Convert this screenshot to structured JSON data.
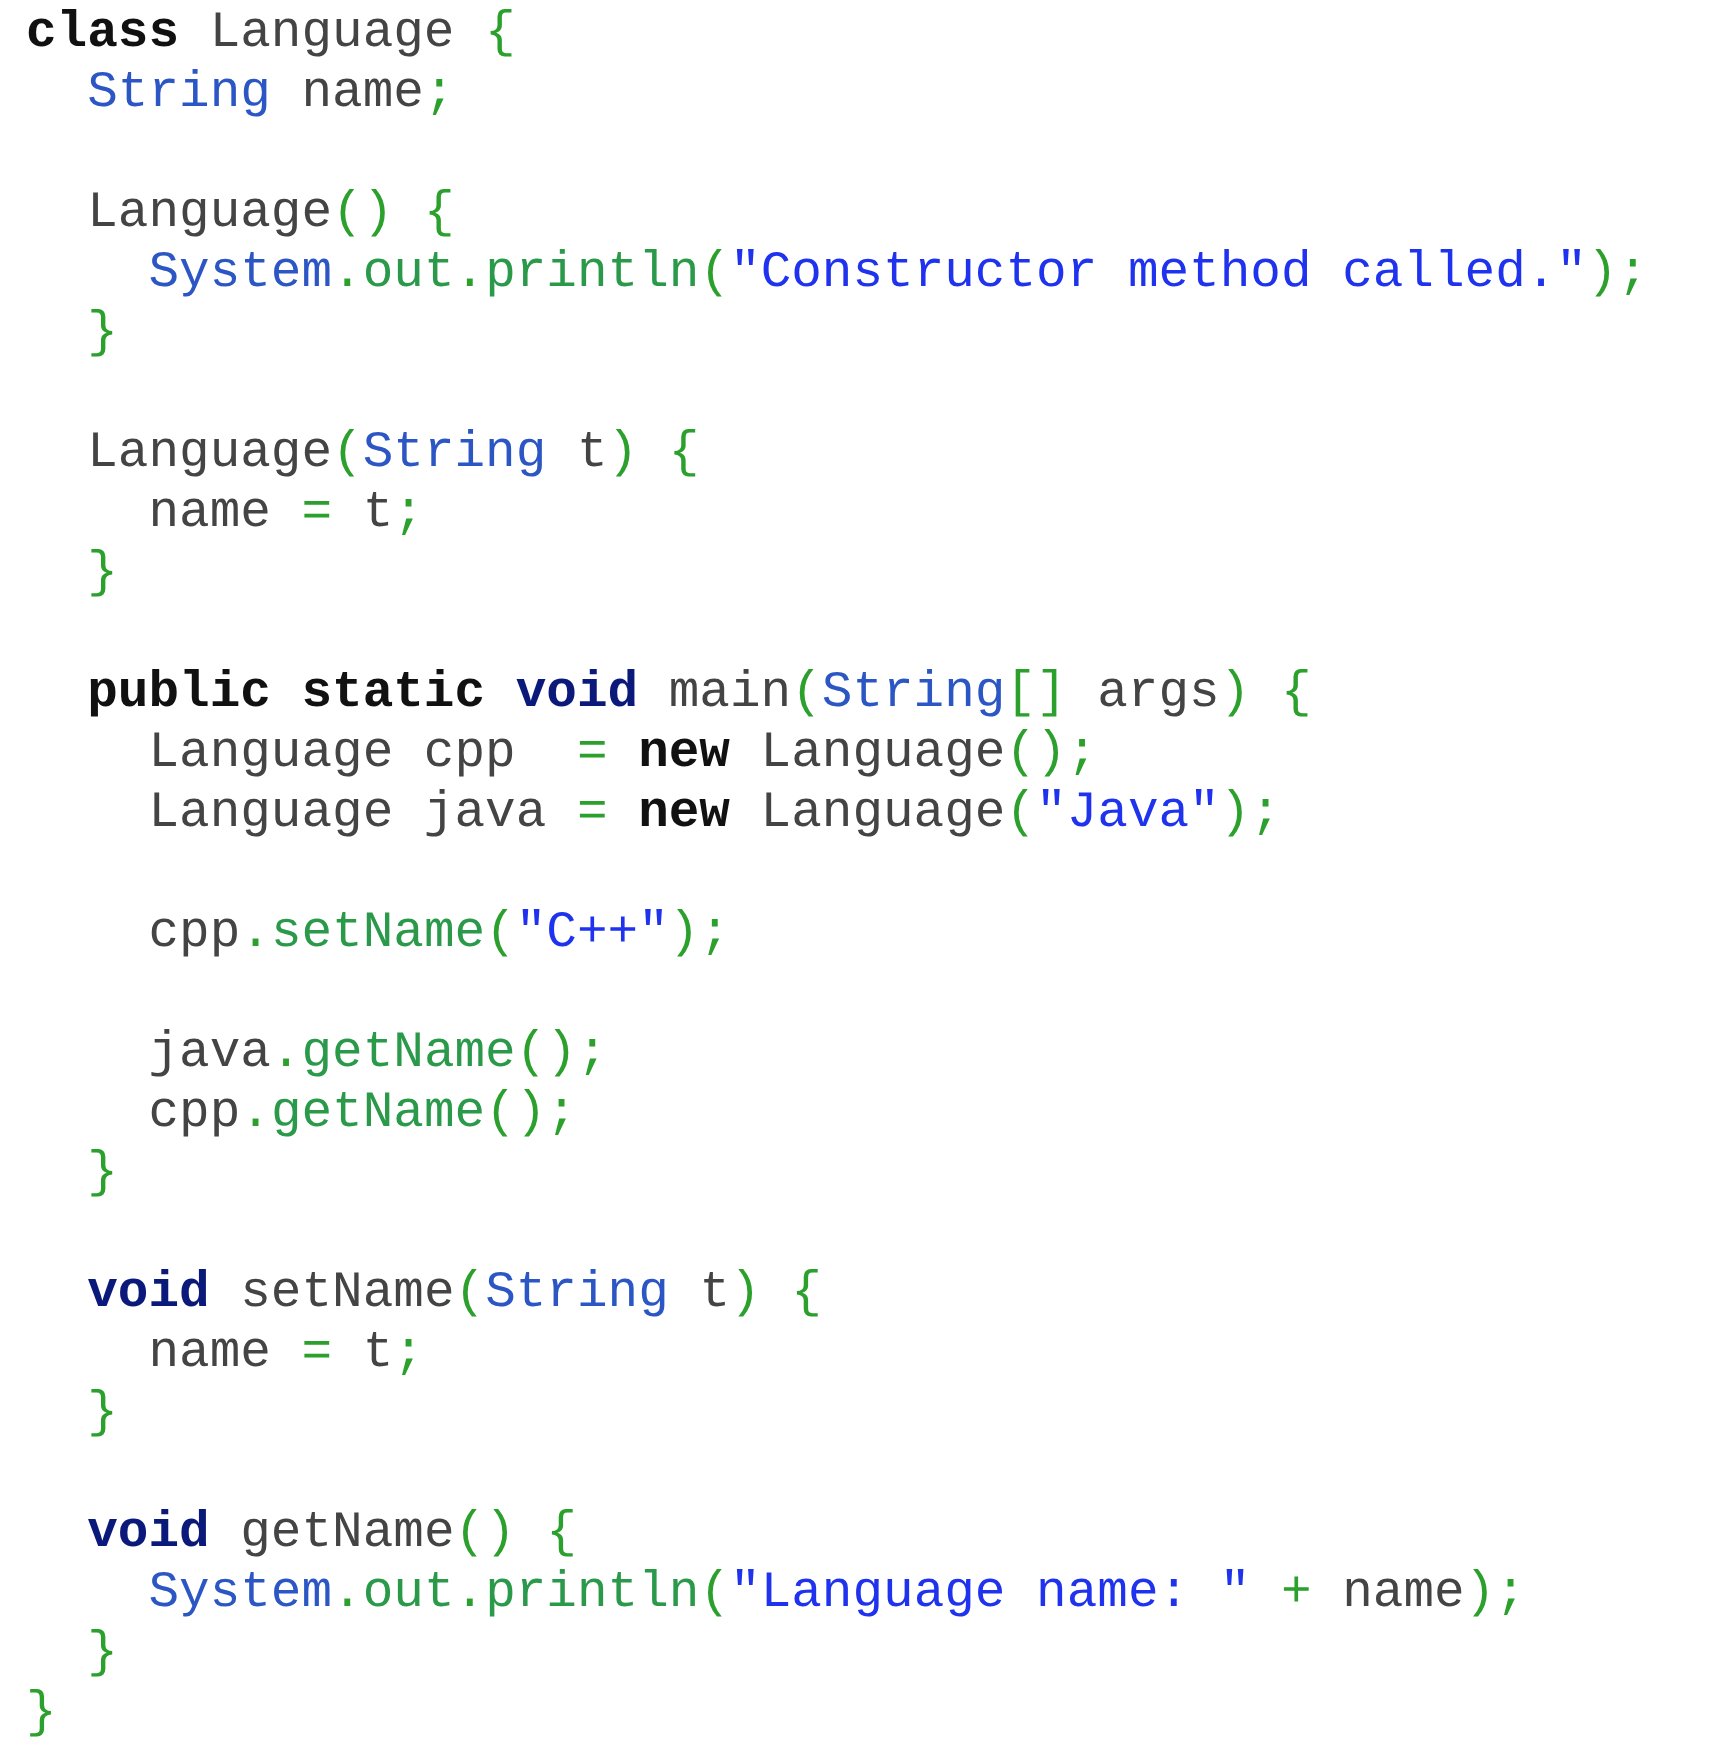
{
  "code_lines": [
    {
      "kind": "code",
      "tokens": [
        {
          "kind": "keyword",
          "text": "class"
        },
        {
          "kind": "plain",
          "text": " Language "
        },
        {
          "kind": "punct",
          "text": "{"
        }
      ]
    },
    {
      "kind": "code",
      "tokens": [
        {
          "kind": "type",
          "text": "  String"
        },
        {
          "kind": "plain",
          "text": " name"
        },
        {
          "kind": "punct",
          "text": ";"
        }
      ]
    },
    {
      "kind": "blank"
    },
    {
      "kind": "code",
      "tokens": [
        {
          "kind": "plain",
          "text": "  Language"
        },
        {
          "kind": "punct",
          "text": "() {"
        }
      ]
    },
    {
      "kind": "code",
      "tokens": [
        {
          "kind": "type",
          "text": "    System"
        },
        {
          "kind": "punct",
          "text": "."
        },
        {
          "kind": "method",
          "text": "out"
        },
        {
          "kind": "punct",
          "text": "."
        },
        {
          "kind": "method",
          "text": "println"
        },
        {
          "kind": "punct",
          "text": "("
        },
        {
          "kind": "string",
          "text": "\"Constructor method called.\""
        },
        {
          "kind": "punct",
          "text": ");"
        }
      ]
    },
    {
      "kind": "code",
      "tokens": [
        {
          "kind": "punct",
          "text": "  }"
        }
      ]
    },
    {
      "kind": "blank"
    },
    {
      "kind": "code",
      "tokens": [
        {
          "kind": "plain",
          "text": "  Language"
        },
        {
          "kind": "punct",
          "text": "("
        },
        {
          "kind": "type",
          "text": "String"
        },
        {
          "kind": "plain",
          "text": " t"
        },
        {
          "kind": "punct",
          "text": ") {"
        }
      ]
    },
    {
      "kind": "code",
      "tokens": [
        {
          "kind": "plain",
          "text": "    name "
        },
        {
          "kind": "punct",
          "text": "= "
        },
        {
          "kind": "plain",
          "text": "t"
        },
        {
          "kind": "punct",
          "text": ";"
        }
      ]
    },
    {
      "kind": "code",
      "tokens": [
        {
          "kind": "punct",
          "text": "  }"
        }
      ]
    },
    {
      "kind": "blank"
    },
    {
      "kind": "code",
      "tokens": [
        {
          "kind": "keyword",
          "text": "  public static "
        },
        {
          "kind": "void",
          "text": "void"
        },
        {
          "kind": "plain",
          "text": " main"
        },
        {
          "kind": "punct",
          "text": "("
        },
        {
          "kind": "type",
          "text": "String"
        },
        {
          "kind": "punct",
          "text": "[]"
        },
        {
          "kind": "plain",
          "text": " args"
        },
        {
          "kind": "punct",
          "text": ") {"
        }
      ]
    },
    {
      "kind": "code",
      "tokens": [
        {
          "kind": "plain",
          "text": "    Language cpp  "
        },
        {
          "kind": "punct",
          "text": "= "
        },
        {
          "kind": "keyword",
          "text": "new"
        },
        {
          "kind": "plain",
          "text": " Language"
        },
        {
          "kind": "punct",
          "text": "();"
        }
      ]
    },
    {
      "kind": "code",
      "tokens": [
        {
          "kind": "plain",
          "text": "    Language java "
        },
        {
          "kind": "punct",
          "text": "= "
        },
        {
          "kind": "keyword",
          "text": "new"
        },
        {
          "kind": "plain",
          "text": " Language"
        },
        {
          "kind": "punct",
          "text": "("
        },
        {
          "kind": "string",
          "text": "\"Java\""
        },
        {
          "kind": "punct",
          "text": ");"
        }
      ]
    },
    {
      "kind": "blank"
    },
    {
      "kind": "code",
      "tokens": [
        {
          "kind": "plain",
          "text": "    cpp"
        },
        {
          "kind": "punct",
          "text": "."
        },
        {
          "kind": "method",
          "text": "setName"
        },
        {
          "kind": "punct",
          "text": "("
        },
        {
          "kind": "string",
          "text": "\"C++\""
        },
        {
          "kind": "punct",
          "text": ");"
        }
      ]
    },
    {
      "kind": "blank"
    },
    {
      "kind": "code",
      "tokens": [
        {
          "kind": "plain",
          "text": "    java"
        },
        {
          "kind": "punct",
          "text": "."
        },
        {
          "kind": "method",
          "text": "getName"
        },
        {
          "kind": "punct",
          "text": "();"
        }
      ]
    },
    {
      "kind": "code",
      "tokens": [
        {
          "kind": "plain",
          "text": "    cpp"
        },
        {
          "kind": "punct",
          "text": "."
        },
        {
          "kind": "method",
          "text": "getName"
        },
        {
          "kind": "punct",
          "text": "();"
        }
      ]
    },
    {
      "kind": "code",
      "tokens": [
        {
          "kind": "punct",
          "text": "  }"
        }
      ]
    },
    {
      "kind": "blank"
    },
    {
      "kind": "code",
      "tokens": [
        {
          "kind": "void",
          "text": "  void"
        },
        {
          "kind": "plain",
          "text": " setName"
        },
        {
          "kind": "punct",
          "text": "("
        },
        {
          "kind": "type",
          "text": "String"
        },
        {
          "kind": "plain",
          "text": " t"
        },
        {
          "kind": "punct",
          "text": ") {"
        }
      ]
    },
    {
      "kind": "code",
      "tokens": [
        {
          "kind": "plain",
          "text": "    name "
        },
        {
          "kind": "punct",
          "text": "= "
        },
        {
          "kind": "plain",
          "text": "t"
        },
        {
          "kind": "punct",
          "text": ";"
        }
      ]
    },
    {
      "kind": "code",
      "tokens": [
        {
          "kind": "punct",
          "text": "  }"
        }
      ]
    },
    {
      "kind": "blank"
    },
    {
      "kind": "code",
      "tokens": [
        {
          "kind": "void",
          "text": "  void"
        },
        {
          "kind": "plain",
          "text": " getName"
        },
        {
          "kind": "punct",
          "text": "() {"
        }
      ]
    },
    {
      "kind": "code",
      "tokens": [
        {
          "kind": "type",
          "text": "    System"
        },
        {
          "kind": "punct",
          "text": "."
        },
        {
          "kind": "method",
          "text": "out"
        },
        {
          "kind": "punct",
          "text": "."
        },
        {
          "kind": "method",
          "text": "println"
        },
        {
          "kind": "punct",
          "text": "("
        },
        {
          "kind": "string",
          "text": "\"Language name: \""
        },
        {
          "kind": "punct",
          "text": " + "
        },
        {
          "kind": "plain",
          "text": "name"
        },
        {
          "kind": "punct",
          "text": ");"
        }
      ]
    },
    {
      "kind": "code",
      "tokens": [
        {
          "kind": "punct",
          "text": "  }"
        }
      ]
    },
    {
      "kind": "code",
      "tokens": [
        {
          "kind": "punct",
          "text": "}"
        }
      ]
    }
  ]
}
